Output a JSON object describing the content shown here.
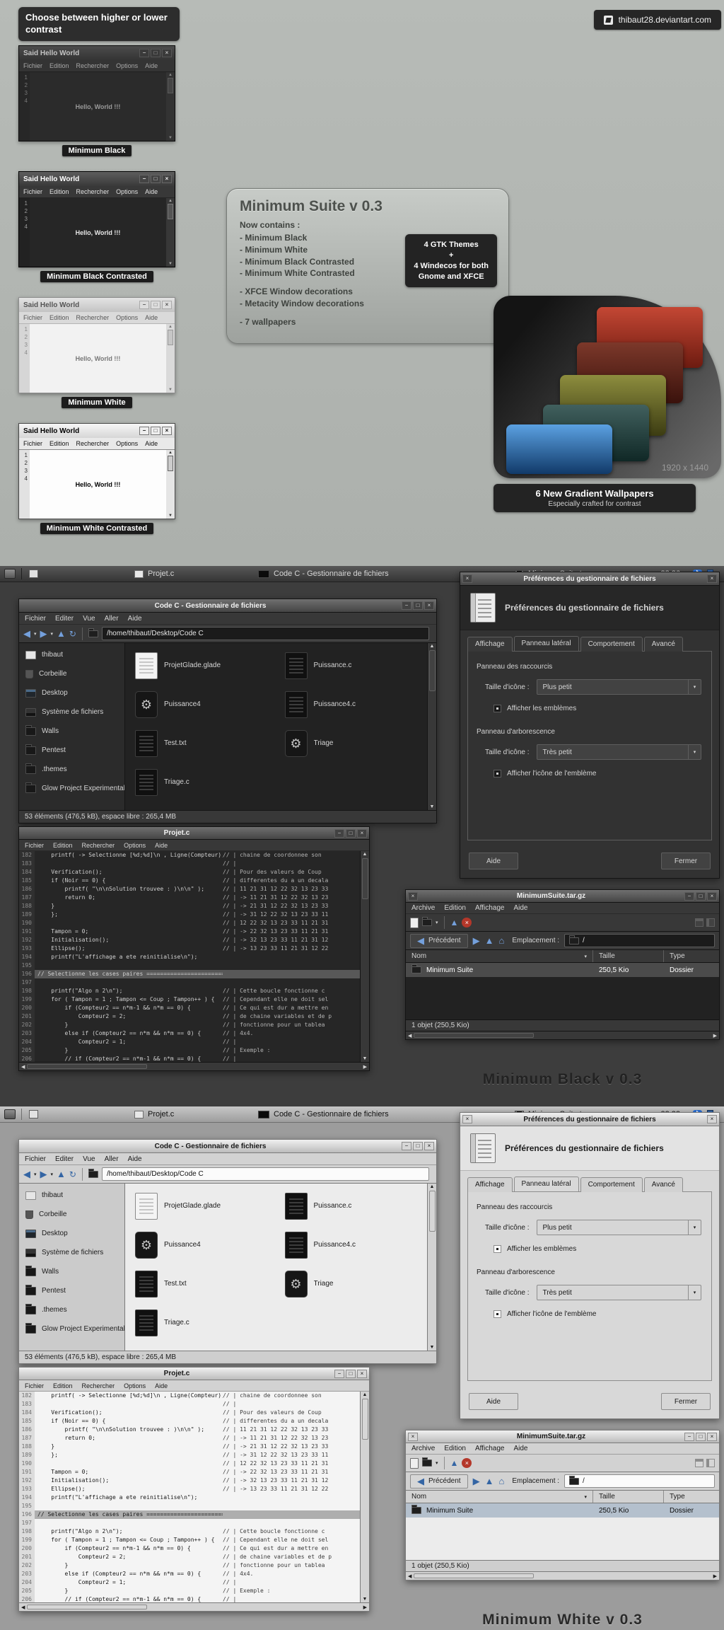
{
  "showcase": {
    "note": "Choose between higher or lower contrast",
    "site": "thibaut28.deviantart.com",
    "demo": {
      "title": "Said Hello World",
      "menu": [
        "Fichier",
        "Edition",
        "Rechercher",
        "Options",
        "Aide"
      ],
      "gutter": [
        "1",
        "2",
        "3",
        "4"
      ],
      "body": "Hello, World !!!",
      "windows": [
        {
          "variant": "black",
          "label": "Minimum Black"
        },
        {
          "variant": "black-c",
          "label": "Minimum Black Contrasted"
        },
        {
          "variant": "white",
          "label": "Minimum White"
        },
        {
          "variant": "white-c",
          "label": "Minimum White Contrasted"
        }
      ]
    },
    "info": {
      "title": "Minimum Suite v 0.3",
      "subtitle": "Now contains :",
      "themes": [
        "- Minimum Black",
        "- Minimum White",
        "- Minimum Black Contrasted",
        "- Minimum White Contrasted"
      ],
      "decorations": [
        "- XFCE Window decorations",
        "- Metacity Window decorations"
      ],
      "extras": [
        "- 7 wallpapers"
      ],
      "badge": [
        "4 GTK Themes",
        "+",
        "4 Windecos for both",
        "Gnome and XFCE"
      ]
    },
    "wallpapers": {
      "resolution": "1920 x 1440",
      "badge_title": "6 New Gradient Wallpapers",
      "badge_subtitle": "Especially crafted for contrast",
      "tile_colors": [
        "#b8402f",
        "#6e2d20",
        "#86863a",
        "#3a5a58",
        "#3e7fc1"
      ]
    }
  },
  "desktop": {
    "taskbar": {
      "tasks": [
        {
          "label": "Projet.c",
          "icon": "editor"
        },
        {
          "label": "Code C - Gestionnaire de fichiers",
          "icon": "fm"
        },
        {
          "label": "MinimumSuite.tar.gz",
          "icon": "archive"
        }
      ]
    },
    "fm": {
      "title": "Code C - Gestionnaire de fichiers",
      "menu": [
        "Fichier",
        "Editer",
        "Vue",
        "Aller",
        "Aide"
      ],
      "path": "/home/thibaut/Desktop/Code C",
      "places": [
        {
          "label": "thibaut",
          "icon": "home"
        },
        {
          "label": "Corbeille",
          "icon": "trash"
        },
        {
          "label": "Desktop",
          "icon": "desktop"
        },
        {
          "label": "Système de fichiers",
          "icon": "drive"
        },
        {
          "label": "Walls",
          "icon": "folder"
        },
        {
          "label": "Pentest",
          "icon": "folder"
        },
        {
          "label": ".themes",
          "icon": "folder"
        },
        {
          "label": "Glow Project Experimental",
          "icon": "folder"
        }
      ],
      "files": [
        {
          "name": "ProjetGlade.glade",
          "icon": "glade"
        },
        {
          "name": "Puissance.c",
          "icon": "source"
        },
        {
          "name": "Puissance4",
          "icon": "exec"
        },
        {
          "name": "Puissance4.c",
          "icon": "source"
        },
        {
          "name": "Test.txt",
          "icon": "text"
        },
        {
          "name": "Triage",
          "icon": "exec"
        },
        {
          "name": "Triage.c",
          "icon": "source"
        }
      ],
      "status": "53 éléments (476,5 kB), espace libre : 265,4 MB"
    },
    "prefs": {
      "title": "Préférences du gestionnaire de fichiers",
      "tabs": [
        {
          "label": "Affichage"
        },
        {
          "label": "Panneau latéral",
          "active": true
        },
        {
          "label": "Comportement"
        },
        {
          "label": "Avancé"
        }
      ],
      "shortcuts_group": "Panneau des raccourcis",
      "icon_size_label": "Taille d'icône :",
      "shortcuts_size": "Plus petit",
      "shortcuts_check": "Afficher les emblèmes",
      "tree_group": "Panneau d'arborescence",
      "tree_size": "Très petit",
      "tree_check": "Afficher l'icône de l'emblème",
      "help_btn": "Aide",
      "close_btn": "Fermer"
    },
    "editor": {
      "title": "Projet.c",
      "menu": [
        "Fichier",
        "Edition",
        "Rechercher",
        "Options",
        "Aide"
      ],
      "lines": [
        {
          "n": "182",
          "c": "    printf( -> Selectionne [%d;%d]\\n , Ligne(Compteur), Colonne(Compteur) );",
          "m": "// | chaine de coordonnee son"
        },
        {
          "n": "183",
          "c": "",
          "m": "// |"
        },
        {
          "n": "184",
          "c": "    Verification();",
          "m": "// | Pour des valeurs de Coup"
        },
        {
          "n": "185",
          "c": "    if (Noir == 0) {",
          "m": "// | differentes du a un decala"
        },
        {
          "n": "186",
          "c": "        printf( \"\\n\\nSolution trouvee : )\\n\\n\" );",
          "m": "// | 11 21 31 12 22 32 13 23 33"
        },
        {
          "n": "187",
          "c": "        return 0;",
          "m": "// | -> 11 21 31 12 22 32 13 23"
        },
        {
          "n": "188",
          "c": "    }",
          "m": "// | -> 21 31 12 22 32 13 23 33"
        },
        {
          "n": "189",
          "c": "    };",
          "m": "// | -> 31 12 22 32 13 23 33 11"
        },
        {
          "n": "190",
          "c": "",
          "m": "// | 12 22 32 13 23 33 11 21 31"
        },
        {
          "n": "191",
          "c": "    Tampon = 0;",
          "m": "// | -> 22 32 13 23 33 11 21 31"
        },
        {
          "n": "192",
          "c": "    Initialisation();",
          "m": "// | -> 32 13 23 33 11 21 31 12"
        },
        {
          "n": "193",
          "c": "    Ellipse();",
          "m": "// | -> 13 23 33 11 21 31 12 22"
        },
        {
          "n": "194",
          "c": "    printf(\"L'affichage a ete reinitialise\\n\");",
          "m": ""
        },
        {
          "n": "195",
          "c": "",
          "m": ""
        },
        {
          "n": "196",
          "c": "// Selectionne les cases paires =====================================",
          "m": "",
          "sel": true
        },
        {
          "n": "197",
          "c": "",
          "m": ""
        },
        {
          "n": "198",
          "c": "    printf(\"Algo n 2\\n\");",
          "m": "// | Cette boucle fonctionne c"
        },
        {
          "n": "199",
          "c": "    for ( Tampon = 1 ; Tampon <= Coup ; Tampon++ ) {",
          "m": "// | Cependant elle ne doit sel"
        },
        {
          "n": "200",
          "c": "        if (Compteur2 == n*m-1 && n*m == 0) {",
          "m": "// | Ce qui est dur a mettre en"
        },
        {
          "n": "201",
          "c": "            Compteur2 = 2;",
          "m": "// | de chaine variables et de p"
        },
        {
          "n": "202",
          "c": "        }",
          "m": "// | fonctionne pour un tablea"
        },
        {
          "n": "203",
          "c": "        else if (Compteur2 == n*m && n*m == 0) {",
          "m": "// | 4x4."
        },
        {
          "n": "204",
          "c": "            Compteur2 = 1;",
          "m": "// |"
        },
        {
          "n": "205",
          "c": "        }",
          "m": "// | Exemple :"
        },
        {
          "n": "206",
          "c": "        // if (Compteur2 == n*m-1 && n*m == 0) {",
          "m": "// |"
        }
      ]
    },
    "archive": {
      "title": "MinimumSuite.tar.gz",
      "menu": [
        "Archive",
        "Edition",
        "Affichage",
        "Aide"
      ],
      "back_btn": "Précédent",
      "location_label": "Emplacement :",
      "location": "/",
      "columns": [
        "Nom",
        "Taille",
        "Type"
      ],
      "rows": [
        {
          "name": "Minimum Suite",
          "size": "250,5 Kio",
          "type": "Dossier"
        }
      ],
      "status": "1 objet (250,5 Kio)"
    }
  },
  "sections": [
    {
      "theme": "dark",
      "clock": "23:26",
      "caption": "Minimum Black v 0.3"
    },
    {
      "theme": "light",
      "clock": "23:32",
      "caption": "Minimum White v 0.3"
    }
  ],
  "icons": {
    "minimize": "−",
    "maximize": "□",
    "close": "×",
    "back": "◀",
    "forward": "▶",
    "up": "▲",
    "refresh": "↻",
    "home": "⌂",
    "dropdown": "▾",
    "scroll_up": "▲",
    "scroll_down": "▼",
    "scroll_left": "◀",
    "scroll_right": "▶",
    "gear": "⚙",
    "stop": "×",
    "bluetooth": "ᛒ"
  },
  "colors": {
    "accent_dark": "#74a0dc",
    "accent_light": "#3465a4",
    "stop_red": "#b4372a"
  }
}
